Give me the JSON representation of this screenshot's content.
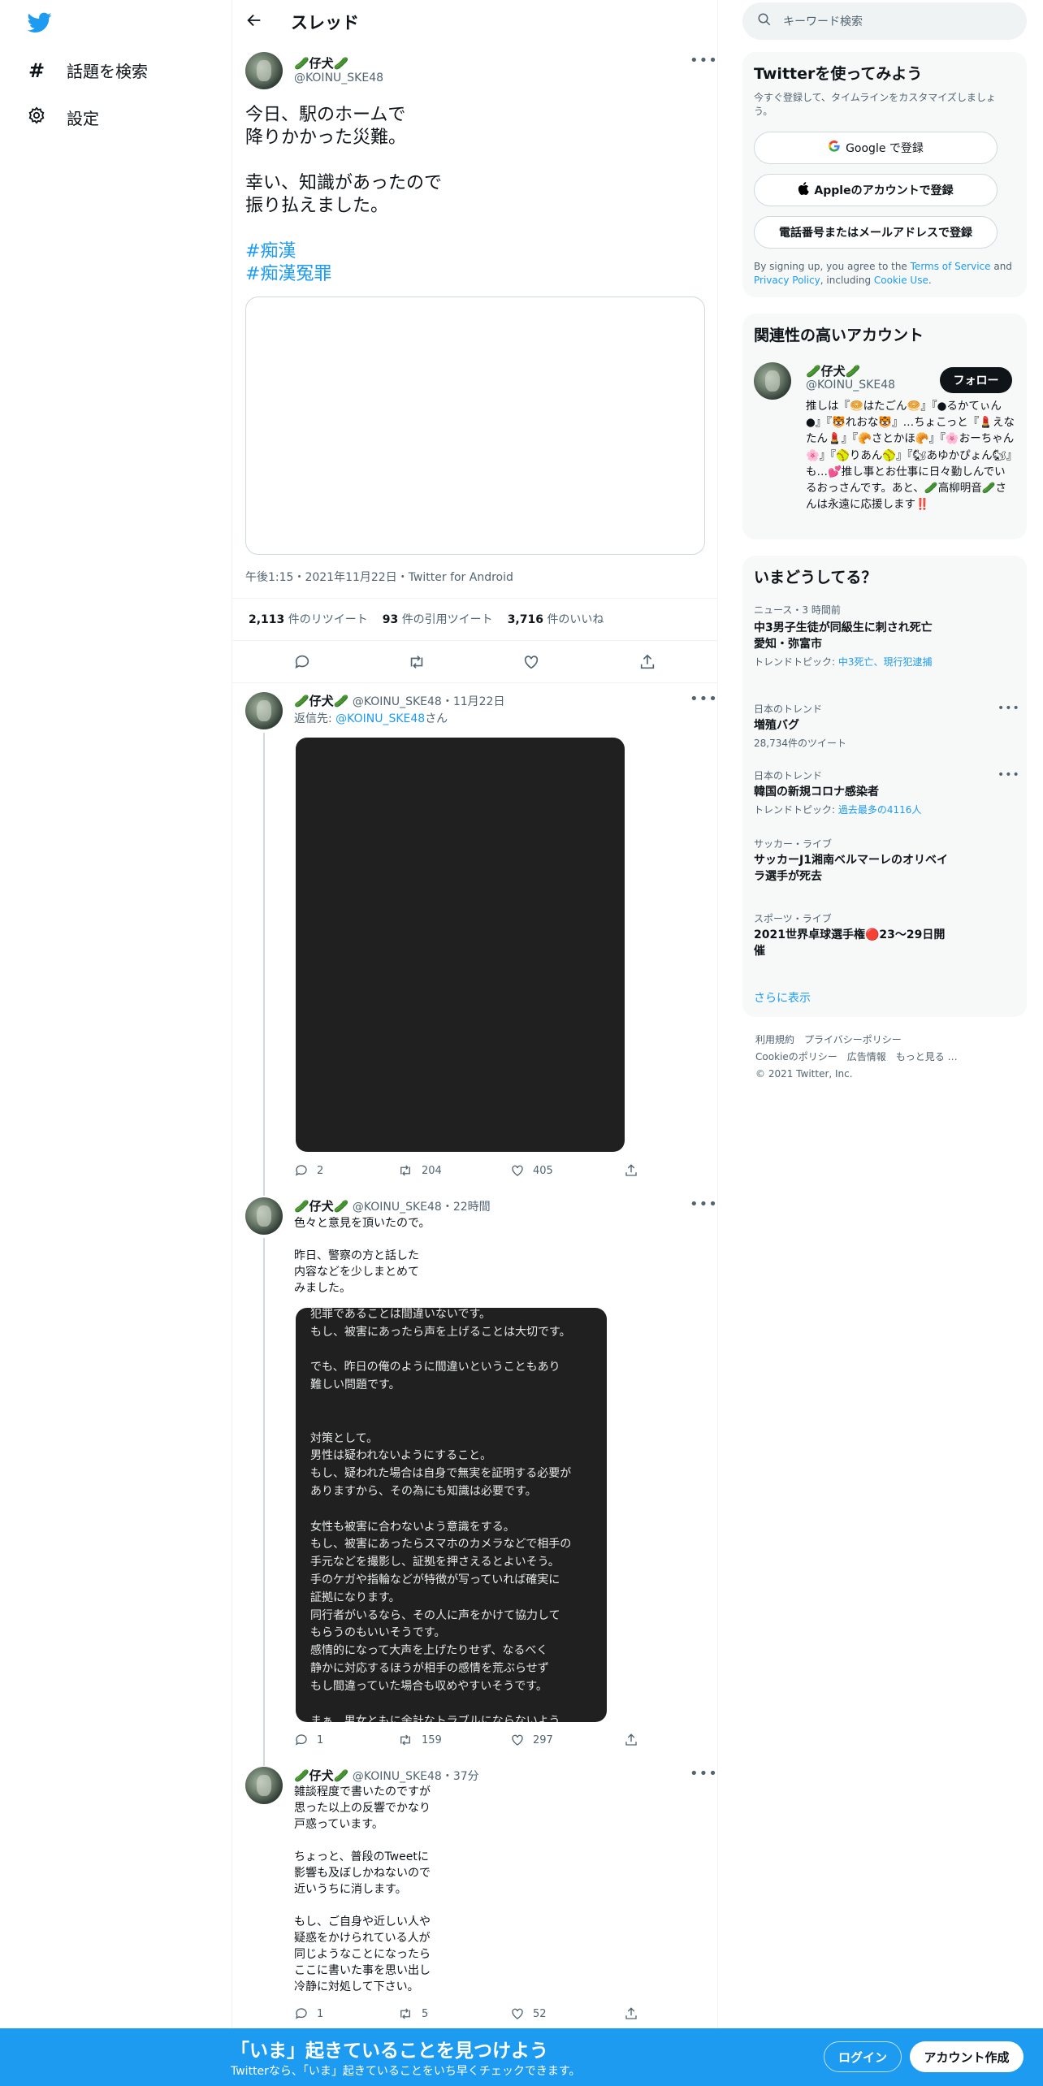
{
  "leftnav": {
    "items": [
      {
        "label": "話題を検索",
        "icon": "hashtag-icon"
      },
      {
        "label": "設定",
        "icon": "gear-icon"
      }
    ]
  },
  "header": {
    "title": "スレッド"
  },
  "main_tweet": {
    "display_name": "🥒仔犬🥒",
    "handle": "@KOINU_SKE48",
    "text": "今日、駅のホームで\n降りかかった災難。\n\n幸い、知識があったので\n振り払えました。",
    "hashtags": [
      "#痴漢",
      "#痴漢冤罪"
    ],
    "meta": "午後1:15・2021年11月22日・Twitter for Android",
    "stats": {
      "retweets_count": "2,113",
      "retweets_label": "件のリツイート",
      "quotes_count": "93",
      "quotes_label": "件の引用ツイート",
      "likes_count": "3,716",
      "likes_label": "件のいいね"
    }
  },
  "replies": [
    {
      "display_name": "🥒仔犬🥒",
      "handle_time": "@KOINU_SKE48・11月22日",
      "reply_prefix": "返信先: ",
      "reply_to": "@KOINU_SKE48",
      "reply_suffix": "さん",
      "counts": {
        "reply": "2",
        "retweet": "204",
        "like": "405"
      }
    },
    {
      "display_name": "🥒仔犬🥒",
      "handle_time": "@KOINU_SKE48・22時間",
      "text": "色々と意見を頂いたので。\n\n昨日、警察の方と話した\n内容などを少しまとめて\nみました。",
      "image_text": "犯罪であることは間違いないです。\nもし、被害にあったら声を上げることは大切です。\n\nでも、昨日の俺のように間違いということもあり\n難しい問題です。\n\n\n対策として。\n男性は疑われないようにすること。\nもし、疑われた場合は自身で無実を証明する必要が\nありますから、その為にも知識は必要です。\n\n女性も被害に合わないよう意識をする。\nもし、被害にあったらスマホのカメラなどで相手の\n手元などを撮影し、証拠を押さえるとよいそう。\n手のケガや指輪などが特徴が写っていれば確実に\n証拠になります。\n同行者がいるなら、その人に声をかけて協力して\nもらうのもいいそうです。\n感情的になって大声を上げたりせず、なるべく\n静かに対応するほうが相手の感情を荒ぶらせず\nもし間違っていた場合も収めやすいそうです。\n\nまぁ、男女ともに余計なトラブルにならないよう\n意識して行動するしかないのでしょうね。",
      "counts": {
        "reply": "1",
        "retweet": "159",
        "like": "297"
      }
    },
    {
      "display_name": "🥒仔犬🥒",
      "handle_time": "@KOINU_SKE48・37分",
      "text": "雑談程度で書いたのですが\n思った以上の反響でかなり\n戸惑っています。\n\nちょっと、普段のTweetに\n影響も及ぼしかねないので\n近いうちに消します。\n\nもし、ご自身や近しい人や\n疑惑をかけられている人が\n同じようなことになったら\nここに書いた事を思い出し\n冷静に対処して下さい。",
      "counts": {
        "reply": "1",
        "retweet": "5",
        "like": "52"
      }
    }
  ],
  "right": {
    "search_placeholder": "キーワード検索",
    "signup": {
      "title": "Twitterを使ってみよう",
      "subtitle": "今すぐ登録して、タイムラインをカスタマイズしましょう。",
      "google": "Google で登録",
      "apple": "Appleのアカウントで登録",
      "phone": "電話番号またはメールアドレスで登録",
      "terms_pre": "By signing up, you agree to the ",
      "terms_link": "Terms of Service",
      "terms_mid": " and ",
      "privacy_link": "Privacy Policy",
      "terms_mid2": ", including ",
      "cookie_link": "Cookie Use",
      "terms_end": "."
    },
    "related": {
      "title": "関連性の高いアカウント",
      "display_name": "🥒仔犬🥒",
      "handle": "@KOINU_SKE48",
      "follow": "フォロー",
      "bio": "推しは『🥯はたごん🥯』『●るかてぃん●』『🐯れおな🐯』…ちょこっと『💄えなたん💄』『🥐さとかほ🥐』『🌸おーちゃん🌸』『🥎りあん🥎』『🐿あゆかぴょん🐿』も…💕推し事とお仕事に日々勤しんでいるおっさんです。あと、🥒高柳明音🥒さんは永遠に応援します‼️"
    },
    "trends": {
      "title": "いまどうしてる？",
      "items": [
        {
          "category": "ニュース・3 時間前",
          "name": "中3男子生徒が同級生に刺され死亡　愛知・弥富市",
          "sub_pre": "トレンドトピック: ",
          "sub_link": "中3死亡、現行犯逮捕",
          "sub": ""
        },
        {
          "category": "日本のトレンド",
          "name": "増殖バグ",
          "sub_pre": "",
          "sub_link": "",
          "sub": "28,734件のツイート"
        },
        {
          "category": "日本のトレンド",
          "name": "韓国の新規コロナ感染者",
          "sub_pre": "トレンドトピック: ",
          "sub_link": "過去最多の4116人",
          "sub": ""
        },
        {
          "category": "サッカー・ライブ",
          "name": "サッカーJ1湘南ベルマーレのオリベイラ選手が死去",
          "sub_pre": "",
          "sub_link": "",
          "sub": ""
        },
        {
          "category": "スポーツ・ライブ",
          "name": "2021世界卓球選手権🔴23〜29日開催",
          "sub_pre": "",
          "sub_link": "",
          "sub": ""
        }
      ],
      "show_more": "さらに表示"
    },
    "footer": {
      "links": [
        "利用規約",
        "プライバシーポリシー",
        "Cookieのポリシー",
        "広告情報",
        "もっと見る …"
      ],
      "copyright": "© 2021 Twitter, Inc."
    }
  },
  "bottom_bar": {
    "title": "「いま」起きていることを見つけよう",
    "subtitle": "Twitterなら、「いま」起きていることをいち早くチェックできます。",
    "login": "ログイン",
    "signup": "アカウント作成"
  },
  "colors": {
    "accent": "#1d9bf0",
    "text": "#0f1419",
    "muted": "#536471",
    "card": "#f7f9f9"
  }
}
